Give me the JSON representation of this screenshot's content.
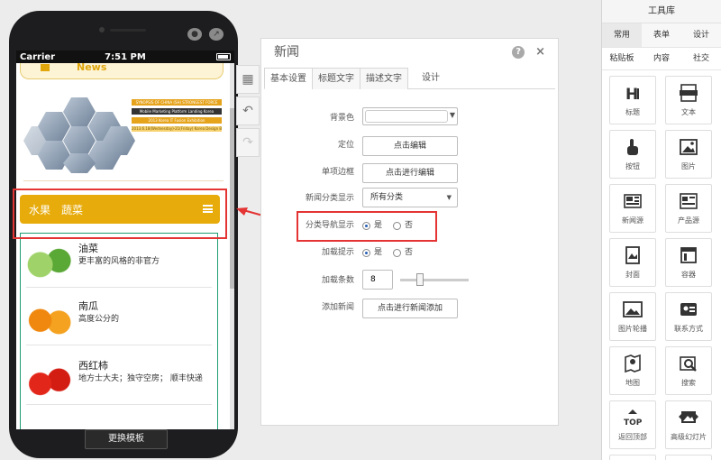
{
  "phone": {
    "status": {
      "carrier": "Carrier",
      "time": "7:51 PM"
    },
    "news_bar": "News",
    "banner_lines": [
      "SYNOPSIS OF CHINA (SH) STRONGEST FORCE",
      "Mobile Marketing Platform Landing Korea",
      "2013 Korea IT Fusion Exhibition",
      "2013.6.18(Wednesday)-21(Friday) Korea Design BEXCO"
    ],
    "category": {
      "items": [
        "水果",
        "蔬菜"
      ]
    },
    "list": [
      {
        "title": "油菜",
        "desc": "更丰富的风格的非官方"
      },
      {
        "title": "南瓜",
        "desc": "高度公分的"
      },
      {
        "title": "西红柿",
        "desc": "地方士大夫；独守空房； 顺丰快递"
      }
    ],
    "switch_button": "更换模板"
  },
  "panel": {
    "title": "新闻",
    "help": "?",
    "close": "×",
    "tabs": [
      "基本设置",
      "标题文字",
      "描述文字",
      "设计"
    ],
    "rows": {
      "bg_color": "背景色",
      "position": "定位",
      "position_btn": "点击编辑",
      "border": "单项边框",
      "border_btn": "点击进行编辑",
      "category_show": "新闻分类显示",
      "category_value": "所有分类",
      "nav_show": "分类导航显示",
      "load_tip": "加载提示",
      "yes": "是",
      "no": "否",
      "load_count": "加载条数",
      "load_count_value": "8",
      "add_news": "添加新闻",
      "add_news_btn": "点击进行新闻添加"
    }
  },
  "toolbox": {
    "title": "工具库",
    "tabs": [
      "常用",
      "表单",
      "设计"
    ],
    "subtabs": [
      "粘贴板",
      "内容",
      "社交"
    ],
    "tools": [
      "标题",
      "文本",
      "按钮",
      "图片",
      "新闻源",
      "产品源",
      "封面",
      "容器",
      "图片轮播",
      "联系方式",
      "地图",
      "搜索",
      "返回顶部",
      "高级幻灯片"
    ]
  },
  "colors": {
    "accent": "#e7ab0b",
    "annotation": "#e43434",
    "list_border": "#1f9d72"
  }
}
